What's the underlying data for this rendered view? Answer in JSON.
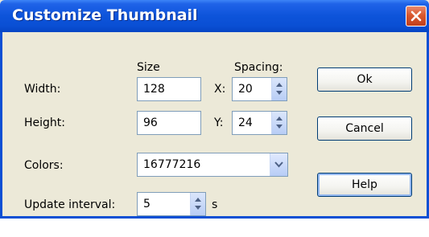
{
  "window": {
    "title": "Customize Thumbnail",
    "title_bar_color": "#0a4fd4"
  },
  "headers": {
    "size": "Size",
    "spacing": "Spacing:"
  },
  "width": {
    "label": "Width:",
    "value": "128"
  },
  "height": {
    "label": "Height:",
    "value": "96"
  },
  "spacing_x": {
    "label": "X:",
    "value": "20"
  },
  "spacing_y": {
    "label": "Y:",
    "value": "24"
  },
  "colors": {
    "label": "Colors:",
    "value": "16777216"
  },
  "update_interval": {
    "label": "Update interval:",
    "value": "5",
    "unit": "s"
  },
  "buttons": {
    "ok": "Ok",
    "cancel": "Cancel",
    "help": "Help"
  },
  "icons": {
    "close": "close-icon",
    "spin": "spin-arrows-icon",
    "dropdown": "chevron-down-icon"
  }
}
